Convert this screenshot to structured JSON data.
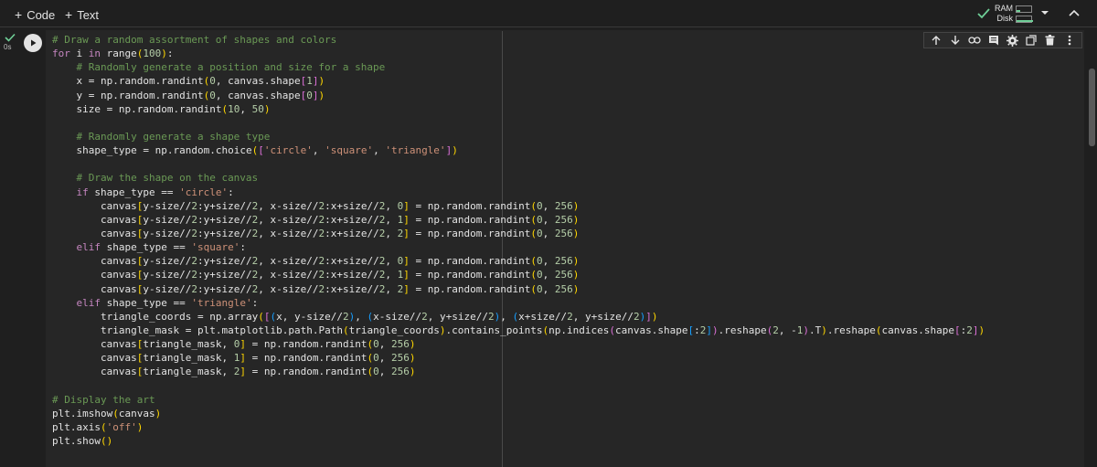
{
  "toolbar": {
    "code_label": "Code",
    "text_label": "Text",
    "ram_label": "RAM",
    "disk_label": "Disk"
  },
  "cell": {
    "exec_time": "0s"
  },
  "code_lines": [
    "# Draw a random assortment of shapes and colors",
    "for i in range(100):",
    "    # Randomly generate a position and size for a shape",
    "    x = np.random.randint(0, canvas.shape[1])",
    "    y = np.random.randint(0, canvas.shape[0])",
    "    size = np.random.randint(10, 50)",
    "",
    "    # Randomly generate a shape type",
    "    shape_type = np.random.choice(['circle', 'square', 'triangle'])",
    "",
    "    # Draw the shape on the canvas",
    "    if shape_type == 'circle':",
    "        canvas[y-size//2:y+size//2, x-size//2:x+size//2, 0] = np.random.randint(0, 256)",
    "        canvas[y-size//2:y+size//2, x-size//2:x+size//2, 1] = np.random.randint(0, 256)",
    "        canvas[y-size//2:y+size//2, x-size//2:x+size//2, 2] = np.random.randint(0, 256)",
    "    elif shape_type == 'square':",
    "        canvas[y-size//2:y+size//2, x-size//2:x+size//2, 0] = np.random.randint(0, 256)",
    "        canvas[y-size//2:y+size//2, x-size//2:x+size//2, 1] = np.random.randint(0, 256)",
    "        canvas[y-size//2:y+size//2, x-size//2:x+size//2, 2] = np.random.randint(0, 256)",
    "    elif shape_type == 'triangle':",
    "        triangle_coords = np.array([(x, y-size//2), (x-size//2, y+size//2), (x+size//2, y+size//2)])",
    "        triangle_mask = plt.matplotlib.path.Path(triangle_coords).contains_points(np.indices(canvas.shape[:2]).reshape(2, -1).T).reshape(canvas.shape[:2])",
    "        canvas[triangle_mask, 0] = np.random.randint(0, 256)",
    "        canvas[triangle_mask, 1] = np.random.randint(0, 256)",
    "        canvas[triangle_mask, 2] = np.random.randint(0, 256)",
    "",
    "# Display the art",
    "plt.imshow(canvas)",
    "plt.axis('off')",
    "plt.show()"
  ],
  "colors": {
    "comment": "#6a9955",
    "keyword": "#c586c0",
    "number": "#b5cea8",
    "string": "#ce9178"
  }
}
